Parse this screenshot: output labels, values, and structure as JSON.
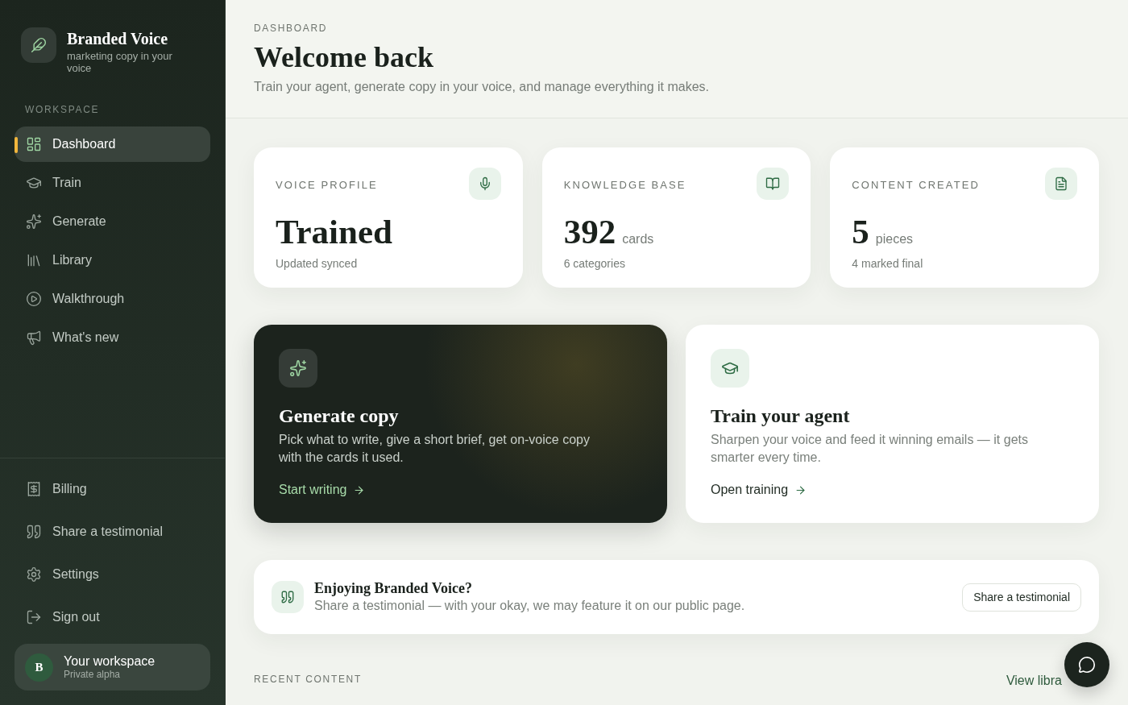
{
  "sidebar": {
    "brand": {
      "name": "Branded Voice",
      "tagline": "marketing copy in your voice"
    },
    "section_label": "WORKSPACE",
    "workspace_items": [
      {
        "label": "Dashboard",
        "selected": true
      },
      {
        "label": "Train",
        "selected": false
      },
      {
        "label": "Generate",
        "selected": false
      },
      {
        "label": "Library",
        "selected": false
      },
      {
        "label": "Walkthrough",
        "selected": false
      },
      {
        "label": "What's new",
        "selected": false
      }
    ],
    "footer_items": [
      {
        "label": "Billing",
        "selected": false
      },
      {
        "label": "Share a testimonial",
        "selected": false
      },
      {
        "label": "Settings",
        "selected": false
      },
      {
        "label": "Sign out",
        "selected": false
      }
    ],
    "workspace": {
      "avatar": "B",
      "name": "Your workspace",
      "plan": "Private alpha"
    }
  },
  "header": {
    "eyebrow": "DASHBOARD",
    "title": "Welcome back",
    "subtitle": "Train your agent, generate copy in your voice, and manage everything it makes."
  },
  "stats": [
    {
      "label": "VOICE PROFILE",
      "value": "Trained",
      "note": "Updated synced"
    },
    {
      "label": "KNOWLEDGE BASE",
      "value": "392",
      "unit": "cards",
      "note": "6 categories"
    },
    {
      "label": "CONTENT CREATED",
      "value": "5",
      "unit": "pieces",
      "note": "4 marked final"
    }
  ],
  "actions": [
    {
      "kind": "dark",
      "title": "Generate copy",
      "description": "Pick what to write, give a short brief, get on-voice copy with the cards it used.",
      "link": "Start writing"
    },
    {
      "kind": "light",
      "title": "Train your agent",
      "description": "Sharpen your voice and feed it winning emails — it gets smarter every time.",
      "link": "Open training"
    }
  ],
  "testimonial_banner": {
    "title": "Enjoying Branded Voice?",
    "text": "Share a testimonial — with your okay, we may feature it on our public page.",
    "button": "Share a testimonial"
  },
  "recent_content": {
    "heading": "RECENT CONTENT",
    "link": "View libra"
  }
}
